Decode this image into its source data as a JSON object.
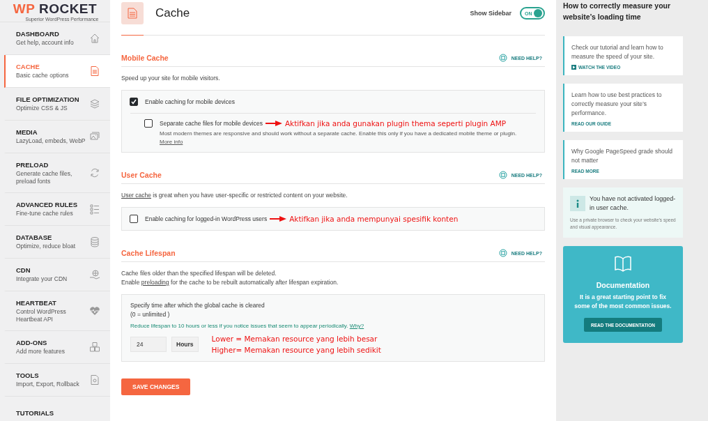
{
  "sidebar": {
    "logo": {
      "brand_first": "WP",
      "brand_second": "ROCKET",
      "tagline": "Superior WordPress Performance"
    },
    "items": [
      {
        "title": "DASHBOARD",
        "subtitle": "Get help, account info",
        "selected": false
      },
      {
        "title": "CACHE",
        "subtitle": "Basic cache options",
        "selected": true
      },
      {
        "title": "FILE OPTIMIZATION",
        "subtitle": "Optimize CSS & JS",
        "selected": false
      },
      {
        "title": "MEDIA",
        "subtitle": "LazyLoad, embeds, WebP",
        "selected": false
      },
      {
        "title": "PRELOAD",
        "subtitle": "Generate cache files, preload fonts",
        "selected": false
      },
      {
        "title": "ADVANCED RULES",
        "subtitle": "Fine-tune cache rules",
        "selected": false
      },
      {
        "title": "DATABASE",
        "subtitle": "Optimize, reduce bloat",
        "selected": false
      },
      {
        "title": "CDN",
        "subtitle": "Integrate your CDN",
        "selected": false
      },
      {
        "title": "HEARTBEAT",
        "subtitle": "Control WordPress Heartbeat API",
        "selected": false
      },
      {
        "title": "ADD-ONS",
        "subtitle": "Add more features",
        "selected": false
      },
      {
        "title": "TOOLS",
        "subtitle": "Import, Export, Rollback",
        "selected": false
      },
      {
        "title": "TUTORIALS",
        "selected": false
      }
    ]
  },
  "header": {
    "title": "Cache",
    "sidebar_toggle": {
      "label": "Show Sidebar",
      "text": "ON",
      "on": true
    }
  },
  "sections": [
    {
      "title": "Mobile Cache",
      "help": "NEED HELP?",
      "description": [
        [
          {
            "kind": "text",
            "text": "Speed up your site for mobile visitors."
          }
        ]
      ],
      "options": [
        {
          "kind": "checkbox",
          "label": "Enable caching for mobile devices",
          "checked": true,
          "children": [
            {
              "kind": "checkbox",
              "label": "Separate cache files for mobile devices",
              "checked": false,
              "annotation": "Aktifkan jika anda gunakan plugin thema seperti plugin AMP",
              "description": [
                {
                  "kind": "text",
                  "text": "Most modern themes are responsive and should work without a separate cache. Enable this only if you have a dedicated mobile theme or plugin. "
                },
                {
                  "kind": "link",
                  "text": "More info"
                }
              ]
            }
          ]
        }
      ]
    },
    {
      "title": "User Cache",
      "help": "NEED HELP?",
      "description": [
        [
          {
            "kind": "link",
            "text": "User cache"
          },
          {
            "kind": "text",
            "text": " is great when you have user-specific or restricted content on your website."
          }
        ]
      ],
      "options": [
        {
          "kind": "checkbox",
          "label": "Enable caching for logged-in WordPress users",
          "checked": false,
          "annotation": "Aktifkan jika anda mempunyai spesifik konten"
        }
      ]
    },
    {
      "title": "Cache Lifespan",
      "help": "NEED HELP?",
      "description": [
        [
          {
            "kind": "text",
            "text": "Cache files older than the specified lifespan will be deleted."
          }
        ],
        [
          {
            "kind": "text",
            "text": "Enable "
          },
          {
            "kind": "link",
            "text": "preloading"
          },
          {
            "kind": "text",
            "text": " for the cache to be rebuilt automatically after lifespan expiration."
          }
        ]
      ],
      "options": [
        {
          "kind": "lifespan",
          "label": "Specify time after which the global cache is cleared",
          "sublabel": "(0 = unlimited )",
          "hint": "Reduce lifespan to 10 hours or less if you notice issues that seem to appear periodically.",
          "hint_link": "Why?",
          "value": "24",
          "unit": "Hours",
          "annotations": [
            "Lower = Memakan resource yang lebih besar",
            "Higher= Memakan resource yang lebih sedikit"
          ]
        }
      ]
    }
  ],
  "save_button": "SAVE CHANGES",
  "right_panel": {
    "heading": "How to correctly measure your website’s loading time",
    "cards": [
      {
        "text": "Check our tutorial and learn how to measure the speed of your site.",
        "link": "WATCH THE VIDEO",
        "video": true
      },
      {
        "text": "Learn how to use best practices to correctly measure your site’s performance.",
        "link": "READ OUR GUIDE",
        "video": false
      },
      {
        "text": "Why Google PageSpeed grade should not matter",
        "link": "READ MORE",
        "video": false
      }
    ],
    "notice": {
      "title": "You have not activated logged-in user cache.",
      "text": "Use a private browser to check your website’s speed and visual appearance."
    },
    "documentation": {
      "title": "Documentation",
      "text": "It is a great starting point to fix some of the most common issues.",
      "button": "READ THE DOCUMENTATION"
    }
  }
}
